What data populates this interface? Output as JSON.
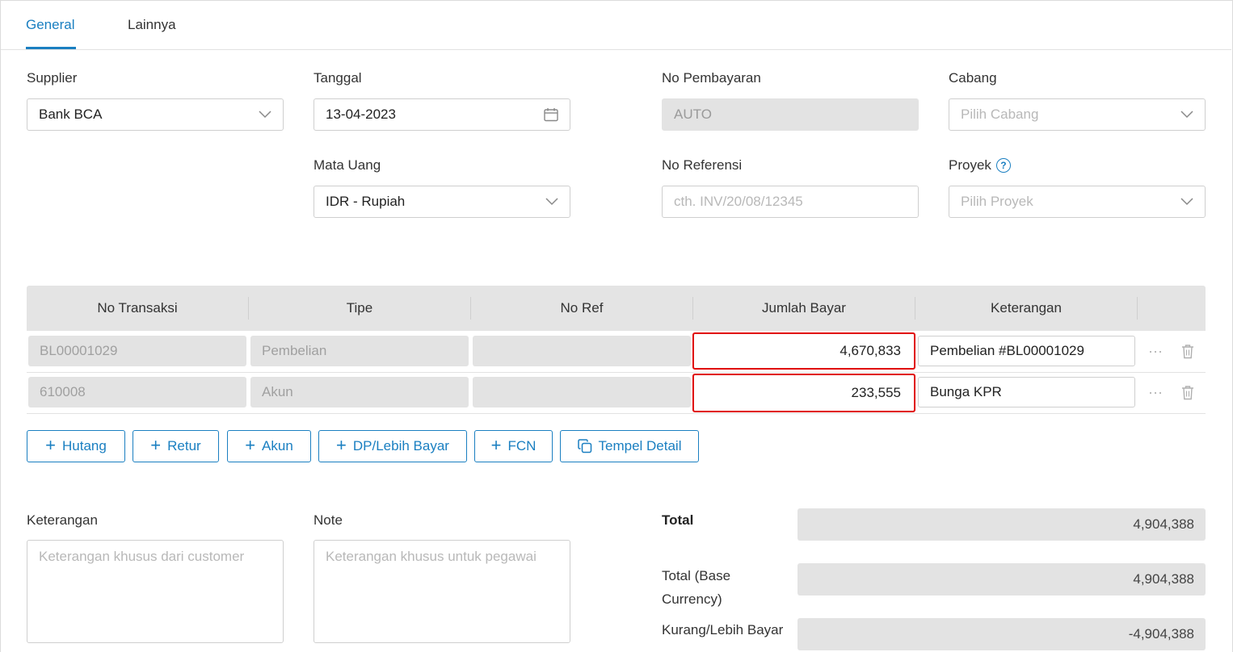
{
  "tabs": [
    {
      "label": "General",
      "active": true
    },
    {
      "label": "Lainnya",
      "active": false
    }
  ],
  "form": {
    "supplier": {
      "label": "Supplier",
      "value": "Bank BCA",
      "icon": "chevron-down-icon"
    },
    "tanggal": {
      "label": "Tanggal",
      "value": "13-04-2023",
      "icon": "calendar-icon"
    },
    "no_pembayaran": {
      "label": "No Pembayaran",
      "value": "AUTO"
    },
    "cabang": {
      "label": "Cabang",
      "placeholder": "Pilih Cabang",
      "icon": "chevron-down-icon"
    },
    "mata_uang": {
      "label": "Mata Uang",
      "value": "IDR - Rupiah",
      "icon": "chevron-down-icon"
    },
    "no_referensi": {
      "label": "No Referensi",
      "placeholder": "cth. INV/20/08/12345"
    },
    "proyek": {
      "label": "Proyek",
      "placeholder": "Pilih Proyek",
      "help_icon": "?",
      "icon": "chevron-down-icon"
    }
  },
  "table": {
    "headers": [
      "No Transaksi",
      "Tipe",
      "No Ref",
      "Jumlah Bayar",
      "Keterangan"
    ],
    "rows": [
      {
        "no_transaksi": "BL00001029",
        "tipe": "Pembelian",
        "no_ref": "",
        "jumlah_bayar": "4,670,833",
        "keterangan": "Pembelian #BL00001029"
      },
      {
        "no_transaksi": "610008",
        "tipe": "Akun",
        "no_ref": "",
        "jumlah_bayar": "233,555",
        "keterangan": "Bunga KPR"
      }
    ],
    "more_glyph": "···"
  },
  "buttons": [
    {
      "label": "Hutang",
      "icon": "plus-icon"
    },
    {
      "label": "Retur",
      "icon": "plus-icon"
    },
    {
      "label": "Akun",
      "icon": "plus-icon"
    },
    {
      "label": "DP/Lebih Bayar",
      "icon": "plus-icon"
    },
    {
      "label": "FCN",
      "icon": "plus-icon"
    },
    {
      "label": "Tempel Detail",
      "icon": "copy-icon"
    }
  ],
  "bottom": {
    "keterangan": {
      "label": "Keterangan",
      "placeholder": "Keterangan khusus dari customer"
    },
    "note": {
      "label": "Note",
      "placeholder": "Keterangan khusus untuk pegawai"
    },
    "total": {
      "label": "Total",
      "value": "4,904,388"
    },
    "total_base_line1": "Total (Base",
    "total_base_line2": "Currency)",
    "total_base_value": "4,904,388",
    "kurang_lebih": {
      "label": "Kurang/Lebih Bayar",
      "value": "-4,904,388"
    }
  },
  "colors": {
    "accent": "#1a7fc1",
    "highlight": "#e00000",
    "disabled_bg": "#e3e3e3"
  }
}
